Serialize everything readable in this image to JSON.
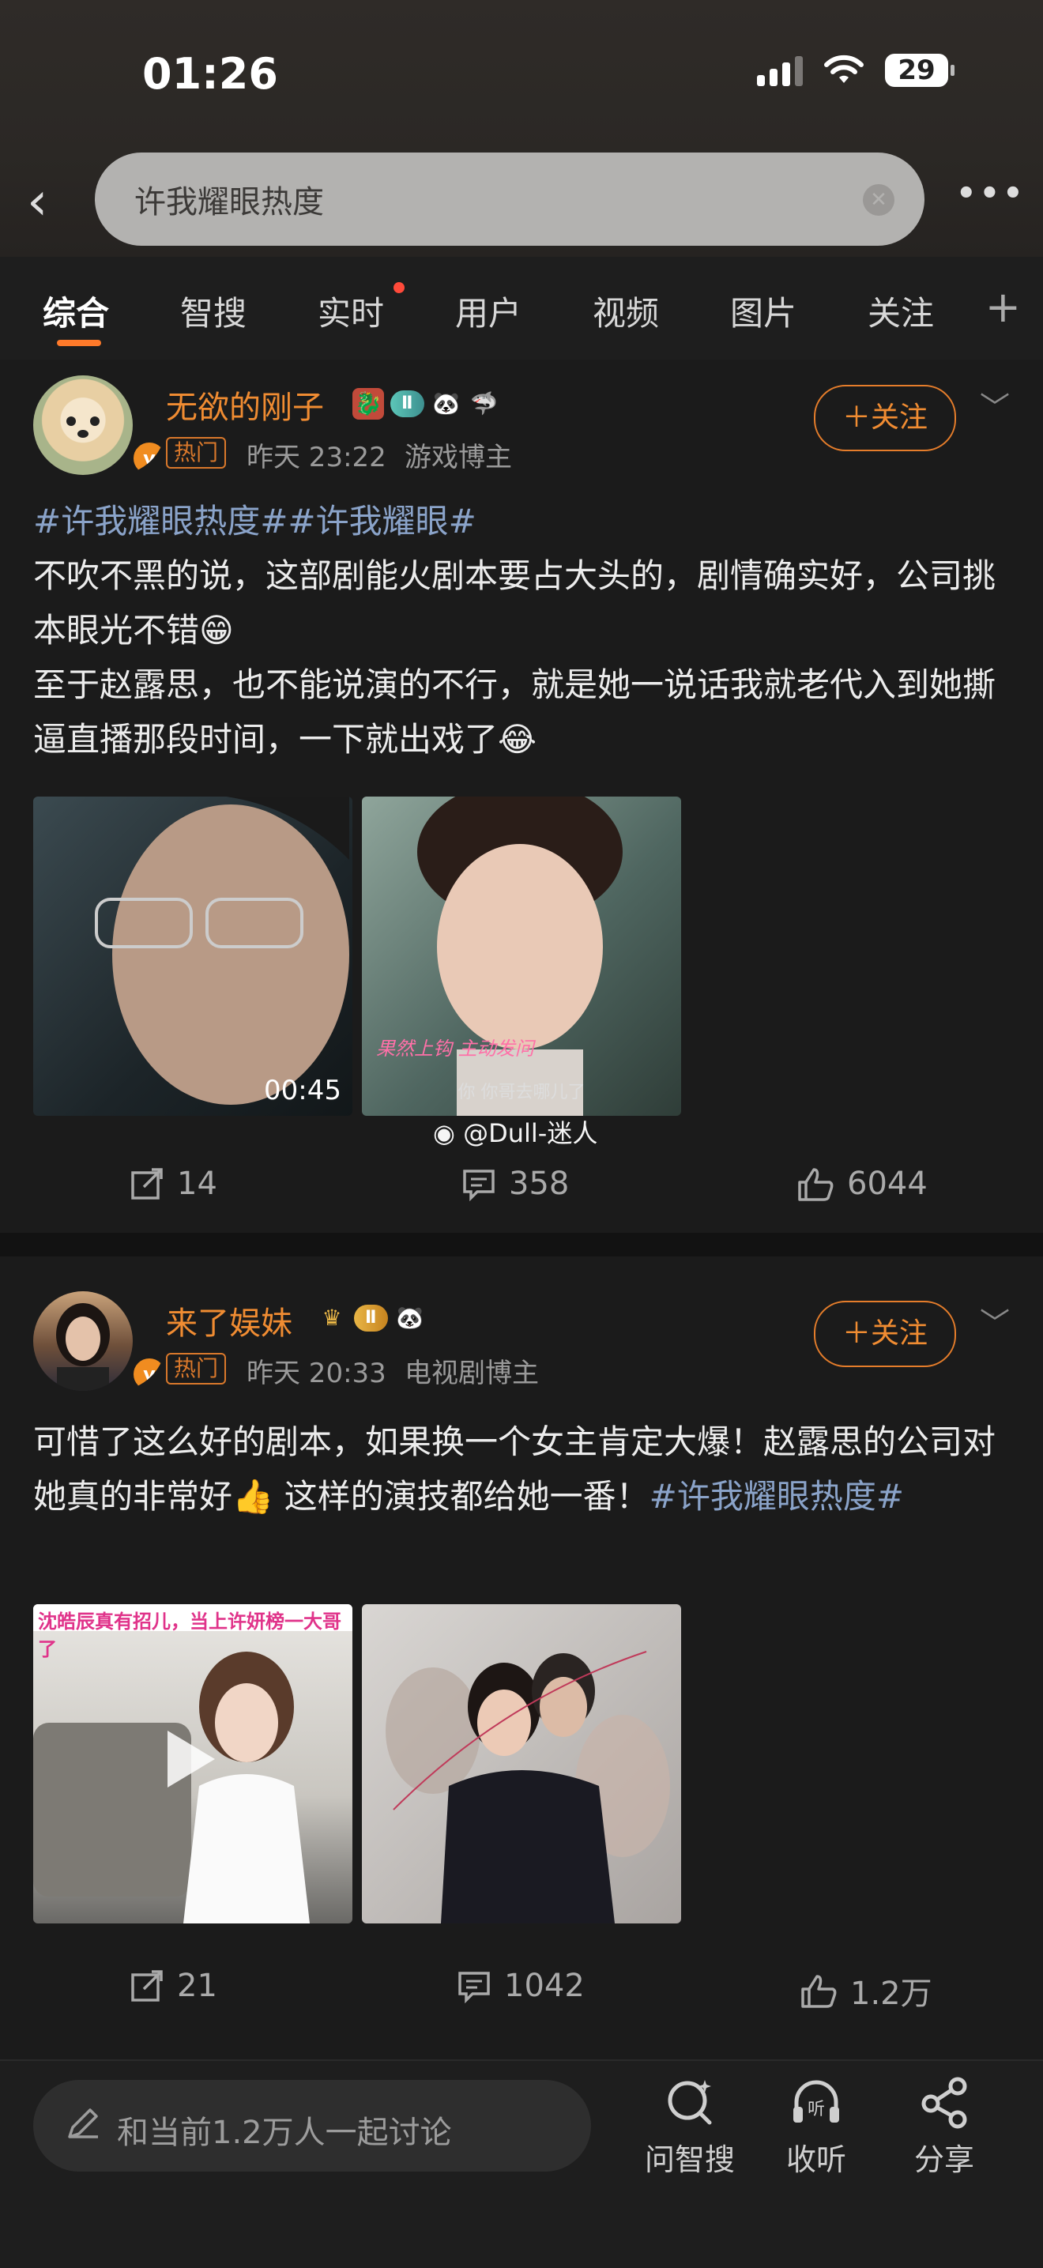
{
  "status_bar": {
    "time": "01:26",
    "battery": "29"
  },
  "search": {
    "query": "许我耀眼热度"
  },
  "tabs": [
    {
      "label": "综合",
      "active": true
    },
    {
      "label": "智搜",
      "active": false
    },
    {
      "label": "实时",
      "active": false,
      "dot": true
    },
    {
      "label": "用户",
      "active": false
    },
    {
      "label": "视频",
      "active": false
    },
    {
      "label": "图片",
      "active": false
    },
    {
      "label": "关注",
      "active": false
    }
  ],
  "posts": [
    {
      "username": "无欲的刚子",
      "level_badge": "Ⅱ",
      "hot_tag": "热门",
      "time": "昨天 23:22",
      "role": "游戏博主",
      "follow_label": "＋关注",
      "topics": "#许我耀眼热度##许我耀眼#",
      "text_line1": "不吹不黑的说，这部剧能火剧本要占大头的，剧情确实好，公司挑本眼光不错",
      "text_line2": "至于赵露思，也不能说演的不行，就是她一说话我就老代入到她撕逼直播那段时间，一下就出戏了",
      "media": [
        {
          "type": "video",
          "duration": "00:45"
        },
        {
          "type": "image",
          "caption": "果然上钩 主动发问",
          "subtitle": "你 你哥去哪儿了"
        }
      ],
      "watermark": "@Dull-迷人",
      "reposts": "14",
      "comments": "358",
      "likes": "6044"
    },
    {
      "username": "来了娱妹",
      "level_badge": "Ⅱ",
      "hot_tag": "热门",
      "time": "昨天 20:33",
      "role": "电视剧博主",
      "follow_label": "＋关注",
      "text": "可惜了这么好的剧本，如果换一个女主肯定大爆！赵露思的公司对她真的非常好",
      "text_after": " 这样的演技都给她一番！",
      "topic": "#许我耀眼热度#",
      "media": [
        {
          "type": "video",
          "banner": "沈皓辰真有招儿，当上许妍榜一大哥了"
        },
        {
          "type": "image"
        }
      ],
      "reposts": "21",
      "comments": "1042",
      "likes": "1.2万"
    }
  ],
  "bottom_bar": {
    "input_placeholder": "和当前1.2万人一起讨论",
    "buttons": [
      "问智搜",
      "收听",
      "分享"
    ]
  },
  "colors": {
    "accent": "#f08c32",
    "topic": "#8aa3c9",
    "background": "#1b1b1b"
  }
}
